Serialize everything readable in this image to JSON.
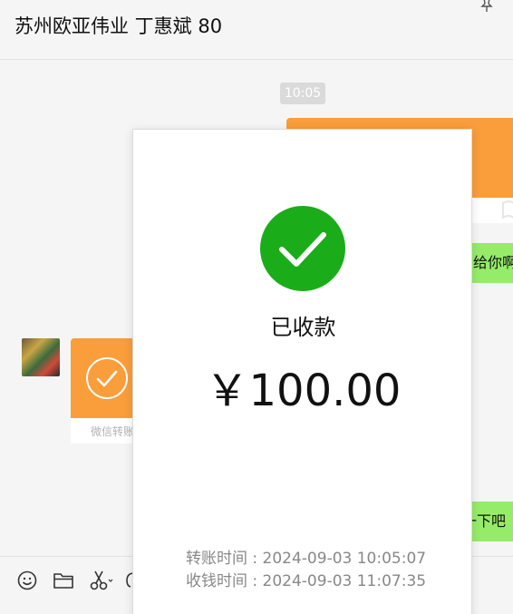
{
  "chat": {
    "title": "苏州欧亚伟业 丁惠斌 80"
  },
  "messages": {
    "timestamp": "10:05",
    "outgoing_text_1": "给你啊",
    "outgoing_text_2": "一下吧",
    "incoming_transfer_label": "微信转账"
  },
  "transfer_detail": {
    "status": "已收款",
    "amount": "￥100.00",
    "transfer_time_label": "转账时间 : 2024-09-03 10:05:07",
    "receive_time_label": "收钱时间 : 2024-09-03 11:07:35"
  },
  "toolbar": {
    "icons": [
      "emoji-icon",
      "folder-icon",
      "screenshot-scissors-icon",
      "chat-history-icon"
    ]
  },
  "colors": {
    "transfer_orange": "#fa9d3b",
    "bubble_green": "#95ec69",
    "success_green": "#1aad19",
    "background": "#f5f5f5"
  }
}
